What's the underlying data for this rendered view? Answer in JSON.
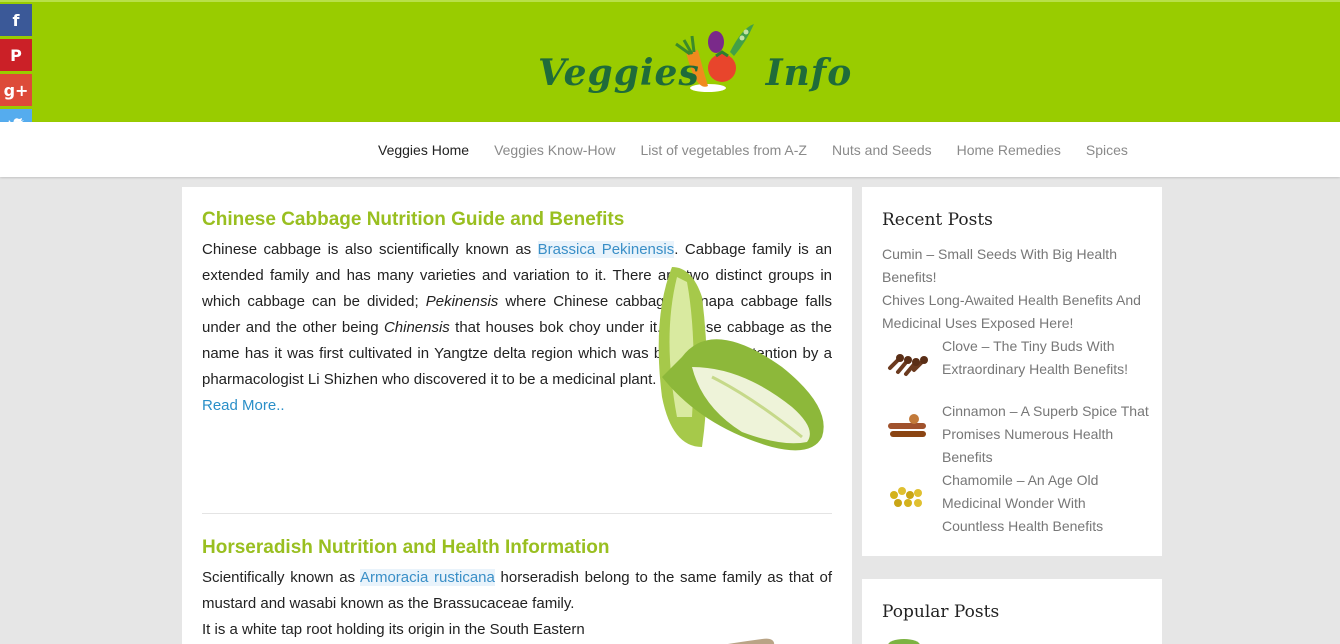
{
  "header": {
    "logo_text_a": "Veggies",
    "logo_text_b": "Info"
  },
  "nav": {
    "items": [
      {
        "label": "Veggies Home",
        "active": true
      },
      {
        "label": "Veggies Know-How",
        "active": false
      },
      {
        "label": "List of vegetables from A-Z",
        "active": false
      },
      {
        "label": "Nuts and Seeds",
        "active": false
      },
      {
        "label": "Home Remedies",
        "active": false
      },
      {
        "label": "Spices",
        "active": false
      }
    ]
  },
  "social": {
    "facebook": "f",
    "pinterest": "P",
    "googleplus": "g+",
    "twitter": "t",
    "share": "⋔"
  },
  "posts": [
    {
      "title": "Chinese Cabbage Nutrition Guide and Benefits",
      "p1_a": "Chinese cabbage is also scientifically known as ",
      "p1_kw": "Brassica Pekinensis",
      "p1_b": ". Cabbage family is an extended family and has many varieties and variation to it. There are two distinct groups in which cabbage can be divided; ",
      "p1_i1": "Pekinensis",
      "p1_c": " where Chinese cabbage or napa cabbage falls under and the other being ",
      "p1_i2": "Chinensis",
      "p1_d": " that houses bok choy under it. Chinese cabbage as the name has it was first cultivated in Yangtze delta region which was brought into attention by a pharmacologist Li Shizhen who discovered it to be a medicinal plant.",
      "read_more": "Read More.."
    },
    {
      "title": "Horseradish Nutrition and Health Information",
      "p1_a": "Scientifically known as ",
      "p1_kw": "Armoracia rusticana",
      "p1_b": " horseradish belong to the same family as that of mustard and wasabi known as the Brassucaceae family.",
      "p2": "It is a white tap root holding its origin in the South Eastern"
    }
  ],
  "sidebar": {
    "recent_title": "Recent Posts",
    "recent": [
      {
        "line1": "Cumin – Small Seeds With Big Health",
        "line2": "Benefits!"
      },
      {
        "line1": "Chives Long-Awaited Health Benefits And",
        "line2": "Medicinal Uses Exposed Here!"
      },
      {
        "line1": "Clove – The Tiny Buds With",
        "line2": "Extraordinary Health Benefits!"
      },
      {
        "line1": "Cinnamon – A Superb Spice That",
        "line2": "Promises Numerous Health",
        "line3": "Benefits"
      },
      {
        "line1": "Chamomile – An Age Old",
        "line2": "Medicinal Wonder With",
        "line3": "Countless Health Benefits"
      }
    ],
    "popular_title": "Popular Posts"
  }
}
